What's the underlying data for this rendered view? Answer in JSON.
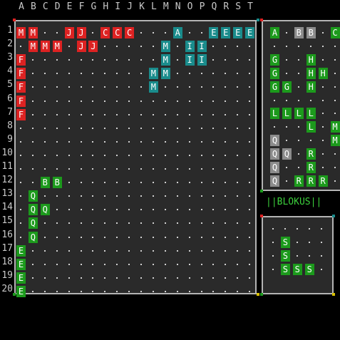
{
  "columns": [
    "A",
    "B",
    "C",
    "D",
    "E",
    "F",
    "G",
    "H",
    "I",
    "J",
    "K",
    "L",
    "M",
    "N",
    "O",
    "P",
    "Q",
    "R",
    "S",
    "T"
  ],
  "rows": [
    "1",
    "2",
    "3",
    "4",
    "5",
    "6",
    "7",
    "8",
    "9",
    "10",
    "11",
    "12",
    "13",
    "14",
    "15",
    "16",
    "17",
    "18",
    "19",
    "20"
  ],
  "colors": {
    "red": "#dd2222",
    "teal": "#1a8c8c",
    "green": "#1c9a1c",
    "gray": "#8c8c8c",
    "board_bg": "#2a2a2a",
    "frame": "#b4b4b4",
    "title": "#3ccf3c"
  },
  "main_board": {
    "pieces": [
      {
        "c": 0,
        "r": 0,
        "l": "M",
        "color": "red"
      },
      {
        "c": 1,
        "r": 0,
        "l": "M",
        "color": "red"
      },
      {
        "c": 1,
        "r": 1,
        "l": "M",
        "color": "red"
      },
      {
        "c": 2,
        "r": 1,
        "l": "M",
        "color": "red"
      },
      {
        "c": 3,
        "r": 1,
        "l": "M",
        "color": "red"
      },
      {
        "c": 4,
        "r": 0,
        "l": "J",
        "color": "red"
      },
      {
        "c": 5,
        "r": 0,
        "l": "J",
        "color": "red"
      },
      {
        "c": 5,
        "r": 1,
        "l": "J",
        "color": "red"
      },
      {
        "c": 6,
        "r": 1,
        "l": "J",
        "color": "red"
      },
      {
        "c": 7,
        "r": 0,
        "l": "C",
        "color": "red"
      },
      {
        "c": 8,
        "r": 0,
        "l": "C",
        "color": "red"
      },
      {
        "c": 9,
        "r": 0,
        "l": "C",
        "color": "red"
      },
      {
        "c": 0,
        "r": 2,
        "l": "F",
        "color": "red"
      },
      {
        "c": 0,
        "r": 3,
        "l": "F",
        "color": "red"
      },
      {
        "c": 0,
        "r": 4,
        "l": "F",
        "color": "red"
      },
      {
        "c": 0,
        "r": 5,
        "l": "F",
        "color": "red"
      },
      {
        "c": 0,
        "r": 6,
        "l": "F",
        "color": "red"
      },
      {
        "c": 13,
        "r": 0,
        "l": "A",
        "color": "teal"
      },
      {
        "c": 16,
        "r": 0,
        "l": "E",
        "color": "teal"
      },
      {
        "c": 17,
        "r": 0,
        "l": "E",
        "color": "teal"
      },
      {
        "c": 18,
        "r": 0,
        "l": "E",
        "color": "teal"
      },
      {
        "c": 19,
        "r": 0,
        "l": "E",
        "color": "teal"
      },
      {
        "c": 12,
        "r": 1,
        "l": "M",
        "color": "teal"
      },
      {
        "c": 12,
        "r": 2,
        "l": "M",
        "color": "teal"
      },
      {
        "c": 12,
        "r": 3,
        "l": "M",
        "color": "teal"
      },
      {
        "c": 11,
        "r": 3,
        "l": "M",
        "color": "teal"
      },
      {
        "c": 11,
        "r": 4,
        "l": "M",
        "color": "teal"
      },
      {
        "c": 14,
        "r": 1,
        "l": "I",
        "color": "teal"
      },
      {
        "c": 15,
        "r": 1,
        "l": "I",
        "color": "teal"
      },
      {
        "c": 14,
        "r": 2,
        "l": "I",
        "color": "teal"
      },
      {
        "c": 15,
        "r": 2,
        "l": "I",
        "color": "teal"
      },
      {
        "c": 2,
        "r": 11,
        "l": "B",
        "color": "green"
      },
      {
        "c": 3,
        "r": 11,
        "l": "B",
        "color": "green"
      },
      {
        "c": 1,
        "r": 12,
        "l": "Q",
        "color": "green"
      },
      {
        "c": 1,
        "r": 13,
        "l": "Q",
        "color": "green"
      },
      {
        "c": 2,
        "r": 13,
        "l": "Q",
        "color": "green"
      },
      {
        "c": 1,
        "r": 14,
        "l": "Q",
        "color": "green"
      },
      {
        "c": 1,
        "r": 15,
        "l": "Q",
        "color": "green"
      },
      {
        "c": 0,
        "r": 16,
        "l": "E",
        "color": "green"
      },
      {
        "c": 0,
        "r": 17,
        "l": "E",
        "color": "green"
      },
      {
        "c": 0,
        "r": 18,
        "l": "E",
        "color": "green"
      },
      {
        "c": 0,
        "r": 19,
        "l": "E",
        "color": "green"
      }
    ]
  },
  "right_top_panel": {
    "pieces": [
      {
        "c": 0,
        "r": 0,
        "l": "A",
        "color": "green"
      },
      {
        "c": 2,
        "r": 0,
        "l": "B",
        "color": "gray"
      },
      {
        "c": 3,
        "r": 0,
        "l": "B",
        "color": "gray"
      },
      {
        "c": 5,
        "r": 0,
        "l": "C",
        "color": "green"
      },
      {
        "c": 0,
        "r": 2,
        "l": "G",
        "color": "green"
      },
      {
        "c": 0,
        "r": 3,
        "l": "G",
        "color": "green"
      },
      {
        "c": 0,
        "r": 4,
        "l": "G",
        "color": "green"
      },
      {
        "c": 1,
        "r": 4,
        "l": "G",
        "color": "green"
      },
      {
        "c": 3,
        "r": 2,
        "l": "H",
        "color": "green"
      },
      {
        "c": 3,
        "r": 3,
        "l": "H",
        "color": "green"
      },
      {
        "c": 4,
        "r": 3,
        "l": "H",
        "color": "green"
      },
      {
        "c": 3,
        "r": 4,
        "l": "H",
        "color": "green"
      },
      {
        "c": 0,
        "r": 6,
        "l": "L",
        "color": "green"
      },
      {
        "c": 1,
        "r": 6,
        "l": "L",
        "color": "green"
      },
      {
        "c": 2,
        "r": 6,
        "l": "L",
        "color": "green"
      },
      {
        "c": 3,
        "r": 6,
        "l": "L",
        "color": "green"
      },
      {
        "c": 3,
        "r": 7,
        "l": "L",
        "color": "green"
      },
      {
        "c": 5,
        "r": 7,
        "l": "M",
        "color": "green"
      },
      {
        "c": 5,
        "r": 8,
        "l": "M",
        "color": "green"
      },
      {
        "c": 0,
        "r": 8,
        "l": "Q",
        "color": "gray"
      },
      {
        "c": 0,
        "r": 9,
        "l": "Q",
        "color": "gray"
      },
      {
        "c": 1,
        "r": 9,
        "l": "Q",
        "color": "gray"
      },
      {
        "c": 0,
        "r": 10,
        "l": "Q",
        "color": "gray"
      },
      {
        "c": 0,
        "r": 11,
        "l": "Q",
        "color": "gray"
      },
      {
        "c": 3,
        "r": 9,
        "l": "R",
        "color": "green"
      },
      {
        "c": 3,
        "r": 10,
        "l": "R",
        "color": "green"
      },
      {
        "c": 2,
        "r": 11,
        "l": "R",
        "color": "green"
      },
      {
        "c": 3,
        "r": 11,
        "l": "R",
        "color": "green"
      },
      {
        "c": 4,
        "r": 11,
        "l": "R",
        "color": "green"
      }
    ]
  },
  "title": "||BLOKUS||",
  "preview_panel": {
    "pieces": [
      {
        "c": 1,
        "r": 1,
        "l": "S",
        "color": "green"
      },
      {
        "c": 1,
        "r": 2,
        "l": "S",
        "color": "green"
      },
      {
        "c": 1,
        "r": 3,
        "l": "S",
        "color": "green"
      },
      {
        "c": 2,
        "r": 3,
        "l": "S",
        "color": "green"
      },
      {
        "c": 3,
        "r": 3,
        "l": "S",
        "color": "green"
      }
    ]
  }
}
